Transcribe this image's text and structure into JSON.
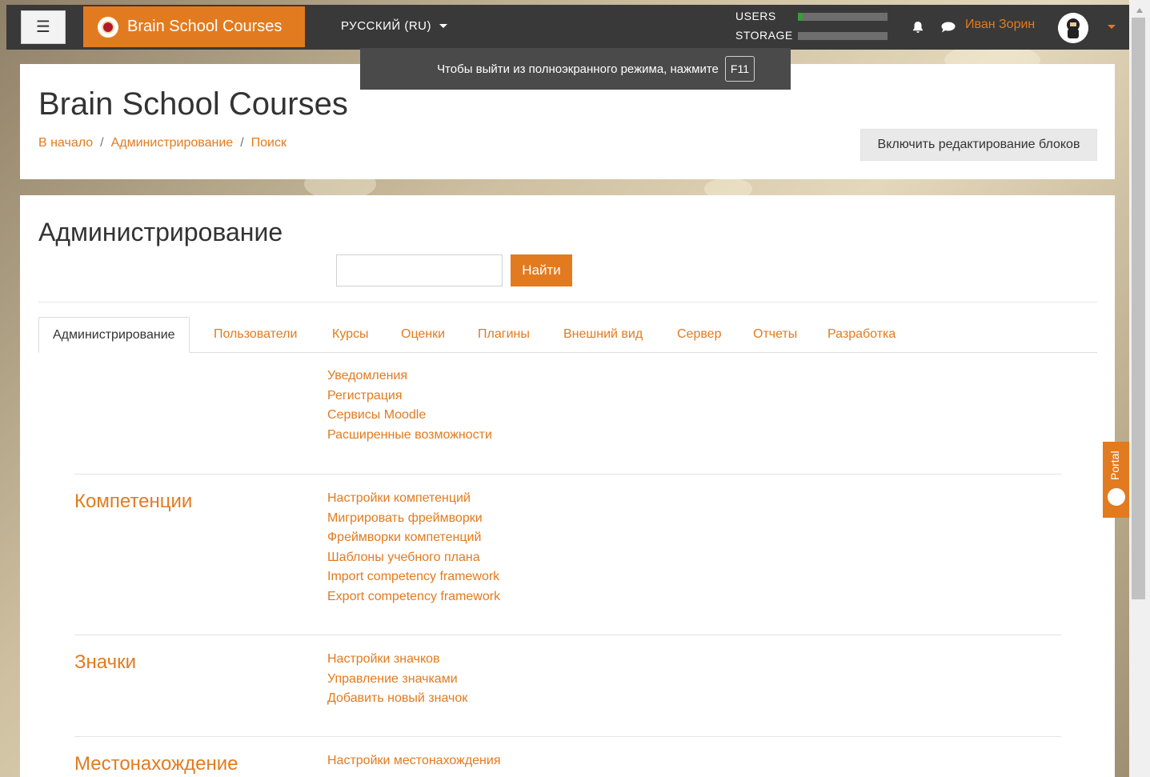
{
  "navbar": {
    "menu_icon": "hamburger-icon",
    "site_name": "Brain School Courses",
    "language": "РУССКИЙ (RU)",
    "quota_users_label": "USERS",
    "quota_storage_label": "STORAGE",
    "quota_users_fill_pct": 5,
    "quota_storage_fill_pct": 0,
    "user_name": "Иван Зорин",
    "accent_color": "#e27b1f"
  },
  "toast": {
    "message": "Чтобы выйти из полноэкранного режима, нажмите",
    "key": "F11"
  },
  "header": {
    "title": "Brain School Courses",
    "breadcrumbs": [
      "В начало",
      "Администрирование",
      "Поиск"
    ],
    "edit_button": "Включить редактирование блоков"
  },
  "main": {
    "heading": "Администрирование",
    "search_button": "Найти",
    "tabs": [
      {
        "label": "Администрирование",
        "active": true
      },
      {
        "label": "Пользователи"
      },
      {
        "label": "Курсы"
      },
      {
        "label": "Оценки"
      },
      {
        "label": "Плагины"
      },
      {
        "label": "Внешний вид"
      },
      {
        "label": "Сервер"
      },
      {
        "label": "Отчеты"
      },
      {
        "label": "Разработка"
      }
    ],
    "sections": [
      {
        "title": "",
        "links": [
          "Уведомления",
          "Регистрация",
          "Сервисы Moodle",
          "Расширенные возможности"
        ]
      },
      {
        "title": "Компетенции",
        "links": [
          "Настройки компетенций",
          "Мигрировать фреймворки",
          "Фреймворки компетенций",
          "Шаблоны учебного плана",
          "Import competency framework",
          "Export competency framework"
        ]
      },
      {
        "title": "Значки",
        "links": [
          "Настройки значков",
          "Управление значками",
          "Добавить новый значок"
        ]
      },
      {
        "title": "Местонахождение",
        "links": [
          "Настройки местонахождения"
        ]
      }
    ]
  },
  "portal": {
    "label": "Portal"
  }
}
